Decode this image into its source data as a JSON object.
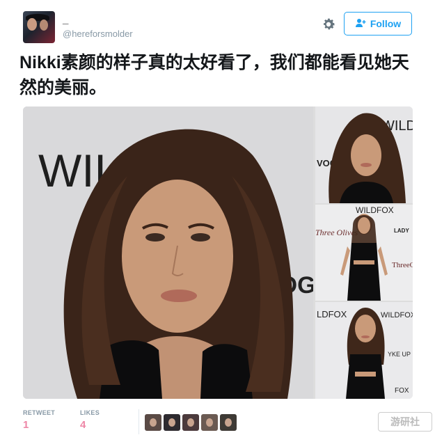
{
  "user": {
    "display_name": "_",
    "handle": "@hereforsmolder"
  },
  "actions": {
    "follow_label": "Follow"
  },
  "icons": {
    "settings": "gear-icon",
    "follow": "add-user-icon"
  },
  "tweet": {
    "text": "Nikki素颜的样子真的太好看了，我们都能看见她天然的美丽。"
  },
  "photos": {
    "main_text_wild": "WIL",
    "main_text_vogue": "VOGUE",
    "side1_text": "WILDF",
    "side1_text2": "VOGU",
    "side2_text_top": "WILDFOX",
    "side2_text_left": "Three Olives",
    "side2_text_right": "LADY",
    "side2_text_right2": "ThreeO",
    "side3_text_left": "LDFOX",
    "side3_text_right": "WILDFOX",
    "side3_text_mid": "YKE UP",
    "side3_text_bottom": "FOX"
  },
  "stats": {
    "retweet_label": "RETWEET",
    "retweet_count": "1",
    "likes_label": "LIKES",
    "likes_count": "4",
    "liker_count": 5
  },
  "watermark": {
    "text": "游研社"
  },
  "colors": {
    "accent": "#1da1f2",
    "muted": "#8899a6",
    "like": "#e0245e"
  }
}
